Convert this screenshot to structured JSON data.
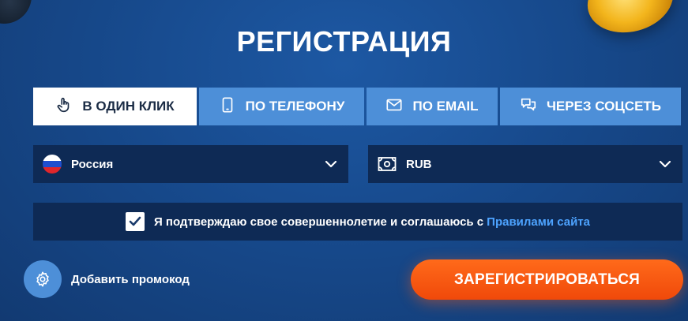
{
  "title": "РЕГИСТРАЦИЯ",
  "tabs": [
    {
      "label": "В ОДИН КЛИК",
      "icon": "hand-pointer-icon",
      "active": true
    },
    {
      "label": "ПО ТЕЛЕФОНУ",
      "icon": "phone-icon",
      "active": false
    },
    {
      "label": "ПО EMAIL",
      "icon": "envelope-icon",
      "active": false
    },
    {
      "label": "ЧЕРЕЗ СОЦСЕТЬ",
      "icon": "chat-bubbles-icon",
      "active": false
    }
  ],
  "country_select": {
    "value": "Россия",
    "icon": "russia-flag-icon"
  },
  "currency_select": {
    "value": "RUB",
    "icon": "banknote-icon"
  },
  "agreement": {
    "checked": true,
    "text": "Я подтверждаю свое совершеннолетие и соглашаюсь с",
    "link": "Правилами сайта"
  },
  "promo": {
    "label": "Добавить промокод",
    "icon": "gear-icon"
  },
  "register_button": {
    "label": "ЗАРЕГИСТРИРОВАТЬСЯ"
  },
  "colors": {
    "background": "#174a8d",
    "tab_inactive": "#4d8fd8",
    "tab_active": "#ffffff",
    "field_bg": "#0e2a55",
    "link": "#4da3ff",
    "cta": "#ff5a14"
  }
}
